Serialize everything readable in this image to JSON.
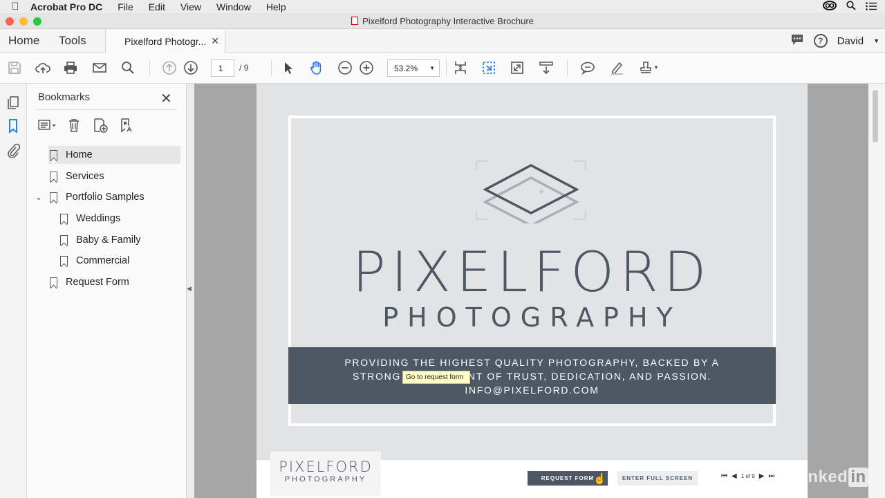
{
  "menubar": {
    "app_name": "Acrobat Pro DC",
    "items": [
      "File",
      "Edit",
      "View",
      "Window",
      "Help"
    ]
  },
  "window": {
    "title": "Pixelford Photography Interactive Brochure"
  },
  "tabs": {
    "home": "Home",
    "tools": "Tools",
    "document_tab": "Pixelford Photogr...",
    "user": "David"
  },
  "toolbar": {
    "current_page": "1",
    "total_pages": "/ 9",
    "zoom": "53.2%"
  },
  "bookmarks": {
    "title": "Bookmarks",
    "items": [
      {
        "label": "Home",
        "level": 0,
        "selected": true
      },
      {
        "label": "Services",
        "level": 0
      },
      {
        "label": "Portfolio Samples",
        "level": 0,
        "expanded": true
      },
      {
        "label": "Weddings",
        "level": 1
      },
      {
        "label": "Baby & Family",
        "level": 1
      },
      {
        "label": "Commercial",
        "level": 1
      },
      {
        "label": "Request Form",
        "level": 0
      }
    ]
  },
  "document": {
    "brand_name": "PIXELFORD",
    "brand_sub": "PHOTOGRAPHY",
    "banner_line1": "PROVIDING THE HIGHEST QUALITY PHOTOGRAPHY, BACKED BY A",
    "banner_line2": "STRONG COMMITMENT OF TRUST, DEDICATION, AND PASSION.",
    "banner_line3": "INFO@PIXELFORD.COM",
    "footer_logo_name": "PIXELFORD",
    "footer_logo_sub": "PHOTOGRAPHY",
    "request_button": "REQUEST FORM",
    "fullscreen_button": "ENTER FULL SCREEN",
    "pager_text": "1 of 9",
    "tooltip": "Go to request form"
  },
  "watermark": {
    "text": "Linked",
    "in": "in"
  },
  "colors": {
    "brand_slate": "#4e5864",
    "page_bg": "#e2e3e5",
    "accent_blue": "#1a73e8"
  }
}
